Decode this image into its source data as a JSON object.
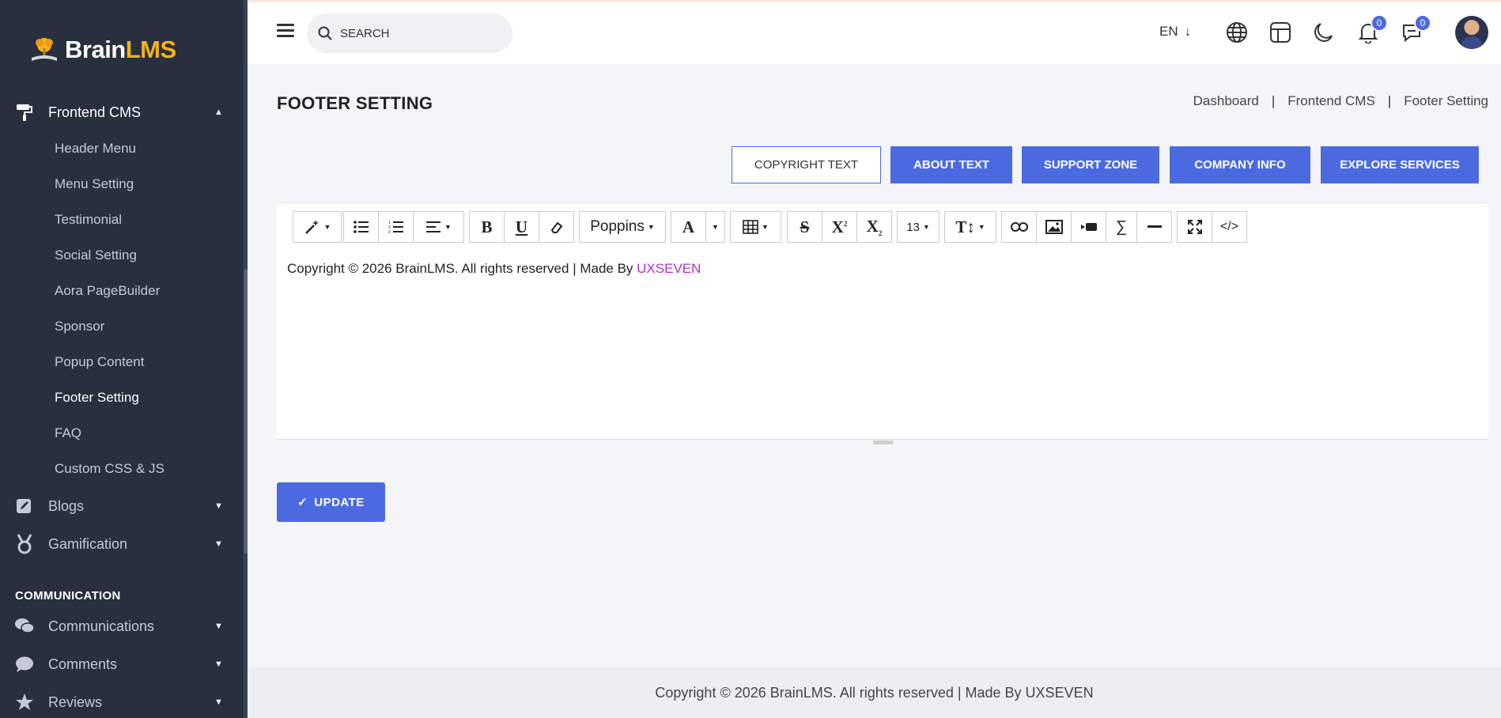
{
  "brand": {
    "name_part1": "Brain",
    "name_part2": "LMS"
  },
  "sidebar": {
    "frontend_cms": {
      "label": "Frontend CMS",
      "caret": "▲"
    },
    "children": [
      {
        "label": "Header Menu"
      },
      {
        "label": "Menu Setting"
      },
      {
        "label": "Testimonial"
      },
      {
        "label": "Social Setting"
      },
      {
        "label": "Aora PageBuilder"
      },
      {
        "label": "Sponsor"
      },
      {
        "label": "Popup Content"
      },
      {
        "label": "Footer Setting"
      },
      {
        "label": "FAQ"
      },
      {
        "label": "Custom CSS & JS"
      }
    ],
    "blogs": {
      "label": "Blogs",
      "caret": "▼"
    },
    "gamification": {
      "label": "Gamification",
      "caret": "▼"
    },
    "section_communication": "COMMUNICATION",
    "communications": {
      "label": "Communications",
      "caret": "▼"
    },
    "comments": {
      "label": "Comments",
      "caret": "▼"
    },
    "reviews": {
      "label": "Reviews",
      "caret": "▼"
    }
  },
  "header": {
    "search_placeholder": "SEARCH",
    "language": "EN",
    "language_arrow": "↓",
    "notifications_count": "0",
    "messages_count": "0"
  },
  "page": {
    "title": "FOOTER SETTING",
    "breadcrumb": [
      "Dashboard",
      "Frontend CMS",
      "Footer Setting"
    ],
    "breadcrumb_sep": "|"
  },
  "tabs": [
    {
      "label": "COPYRIGHT TEXT",
      "active": true
    },
    {
      "label": "ABOUT TEXT"
    },
    {
      "label": "SUPPORT ZONE"
    },
    {
      "label": "COMPANY INFO"
    },
    {
      "label": "EXPLORE SERVICES"
    }
  ],
  "toolbar": {
    "font_name": "Poppins",
    "font_size": "13"
  },
  "editor": {
    "text": "Copyright © 2026 BrainLMS. All rights reserved | Made By ",
    "brand": "UXSEVEN"
  },
  "update_label": "UPDATE",
  "update_check": "✓",
  "footer": {
    "text": "Copyright © 2026 BrainLMS. All rights reserved | Made By UXSEVEN"
  },
  "colors": {
    "accent": "#4c6ae0",
    "sidebar_bg": "#282f3f",
    "brand_orange": "#f6b21a",
    "link_purple": "#b02ed0"
  }
}
